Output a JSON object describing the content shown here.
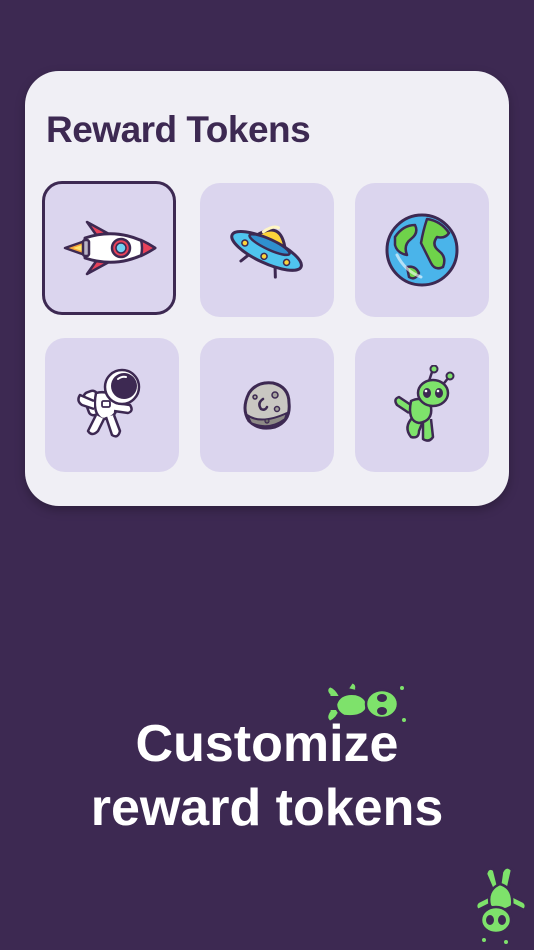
{
  "card": {
    "title": "Reward Tokens",
    "tokens": [
      {
        "icon": "rocket-icon",
        "selected": true
      },
      {
        "icon": "ufo-icon",
        "selected": false
      },
      {
        "icon": "earth-icon",
        "selected": false
      },
      {
        "icon": "astronaut-icon",
        "selected": false
      },
      {
        "icon": "moon-rock-icon",
        "selected": false
      },
      {
        "icon": "alien-icon",
        "selected": false
      }
    ]
  },
  "headline": {
    "line1": "Customize",
    "line2": "reward tokens"
  },
  "colors": {
    "background": "#3d2952",
    "card": "#f0eff5",
    "tile": "#dbd5ee",
    "title": "#3d2952",
    "alien_green": "#7ee26b"
  }
}
